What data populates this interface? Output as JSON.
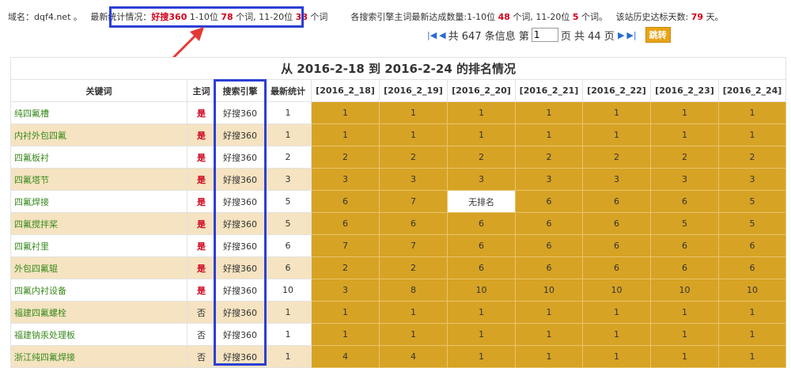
{
  "summary": {
    "domain_label": "域名：dqf4.net 。",
    "latest_label": "最新统计情况：",
    "engine": "好搜360",
    "range1_label": "1-10位",
    "range1_count": "78",
    "unit": "个词,",
    "range2_label": "11-20位",
    "range2_count": "38",
    "unit_end": "个词",
    "main_label": "各搜索引擎主词最新达成数量:1-10位",
    "main_count1": "48",
    "main_unit1": "个词, 11-20位",
    "main_count2": "5",
    "main_unit2": "个词。",
    "history_label": "该站历史达标天数:",
    "history_days": "79",
    "history_unit": "天。"
  },
  "pager": {
    "first_icon": "first-page-icon",
    "prev_icon": "prev-page-icon",
    "next_icon": "next-page-icon",
    "last_icon": "last-page-icon",
    "total_text": "共 647 条信息 第",
    "current_page": "1",
    "pages_text": "页 共 44 页",
    "jump_label": "跳转"
  },
  "table": {
    "title": "从 2016-2-18 到 2016-2-24 的排名情况",
    "headers": [
      "关键词",
      "主词",
      "搜索引擎",
      "最新统计",
      "[2016_2_18]",
      "[2016_2_19]",
      "[2016_2_20]",
      "[2016_2_21]",
      "[2016_2_22]",
      "[2016_2_23]",
      "[2016_2_24]"
    ],
    "rows": [
      {
        "kw": "纯四氟槽",
        "main": "是",
        "engine": "好搜360",
        "latest": "1",
        "ranks": [
          "1",
          "1",
          "1",
          "1",
          "1",
          "1",
          "1"
        ]
      },
      {
        "kw": "内衬外包四氟",
        "main": "是",
        "engine": "好搜360",
        "latest": "1",
        "ranks": [
          "1",
          "1",
          "1",
          "1",
          "1",
          "1",
          "1"
        ]
      },
      {
        "kw": "四氟板衬",
        "main": "是",
        "engine": "好搜360",
        "latest": "2",
        "ranks": [
          "2",
          "2",
          "2",
          "2",
          "2",
          "2",
          "2"
        ]
      },
      {
        "kw": "四氟塔节",
        "main": "是",
        "engine": "好搜360",
        "latest": "3",
        "ranks": [
          "3",
          "3",
          "3",
          "3",
          "3",
          "3",
          "3"
        ]
      },
      {
        "kw": "四氟焊接",
        "main": "是",
        "engine": "好搜360",
        "latest": "5",
        "ranks": [
          "6",
          "7",
          "无排名",
          "6",
          "6",
          "6",
          "5"
        ]
      },
      {
        "kw": "四氟搅拌桨",
        "main": "是",
        "engine": "好搜360",
        "latest": "5",
        "ranks": [
          "6",
          "6",
          "6",
          "6",
          "6",
          "5",
          "5"
        ]
      },
      {
        "kw": "四氟衬里",
        "main": "是",
        "engine": "好搜360",
        "latest": "6",
        "ranks": [
          "7",
          "7",
          "6",
          "6",
          "6",
          "6",
          "6"
        ]
      },
      {
        "kw": "外包四氟辊",
        "main": "是",
        "engine": "好搜360",
        "latest": "6",
        "ranks": [
          "2",
          "2",
          "6",
          "6",
          "6",
          "6",
          "6"
        ]
      },
      {
        "kw": "四氟内衬设备",
        "main": "是",
        "engine": "好搜360",
        "latest": "10",
        "ranks": [
          "3",
          "8",
          "10",
          "10",
          "10",
          "10",
          "10"
        ]
      },
      {
        "kw": "福建四氟螺栓",
        "main": "否",
        "engine": "好搜360",
        "latest": "1",
        "ranks": [
          "1",
          "1",
          "1",
          "1",
          "1",
          "1",
          "1"
        ]
      },
      {
        "kw": "福建钠汞处理板",
        "main": "否",
        "engine": "好搜360",
        "latest": "1",
        "ranks": [
          "1",
          "1",
          "1",
          "1",
          "1",
          "1",
          "1"
        ]
      },
      {
        "kw": "浙江纯四氟焊接",
        "main": "否",
        "engine": "好搜360",
        "latest": "1",
        "ranks": [
          "4",
          "4",
          "1",
          "1",
          "1",
          "1",
          "1"
        ]
      }
    ]
  }
}
